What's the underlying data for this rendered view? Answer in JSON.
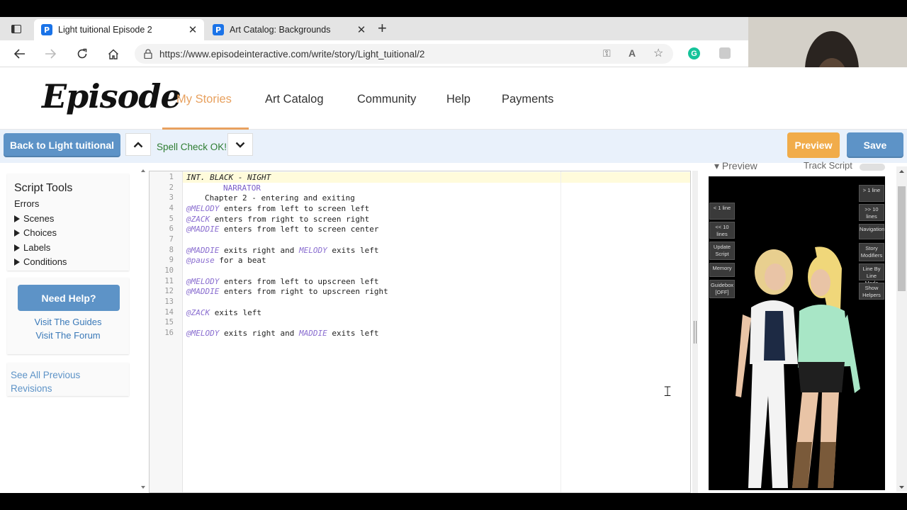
{
  "browser": {
    "tabs": [
      {
        "label": "Light tuitional Episode 2",
        "favicon": "P",
        "active": true
      },
      {
        "label": "Art Catalog: Backgrounds",
        "favicon": "P",
        "active": false
      }
    ],
    "url": "https://www.episodeinteractive.com/write/story/Light_tuitional/2",
    "grammarly_badge": "G"
  },
  "site": {
    "logo": "Episode",
    "nav": [
      "My Stories",
      "Art Catalog",
      "Community",
      "Help",
      "Payments"
    ],
    "active_nav": "My Stories",
    "accent_color": "#e8a15f"
  },
  "toolbar": {
    "back_label": "Back to Light tuitional",
    "spell_status": "Spell Check OK!",
    "preview_label": "Preview",
    "save_label": "Save"
  },
  "sidebar": {
    "title": "Script Tools",
    "errors": "Errors",
    "sections": [
      "Scenes",
      "Choices",
      "Labels",
      "Conditions"
    ],
    "help_button": "Need Help?",
    "guides_link": "Visit The Guides",
    "forum_link": "Visit The Forum",
    "revisions_link": "See All Previous Revisions"
  },
  "editor": {
    "line_numbers": [
      "1",
      "2",
      "3",
      "4",
      "5",
      "6",
      "7",
      "8",
      "9",
      "10",
      "11",
      "12",
      "13",
      "14",
      "15",
      "16"
    ],
    "lines": {
      "l1": "INT. BLACK - NIGHT",
      "l2": "NARRATOR",
      "l3": "Chapter 2 - entering and exiting",
      "l4a": "@MELODY",
      "l4b": " enters from left to screen left",
      "l5a": "@ZACK",
      "l5b": " enters from right to screen right",
      "l6a": "@MADDIE",
      "l6b": " enters from left to screen center",
      "l8a": "@MADDIE",
      "l8b": " exits right and ",
      "l8c": "MELODY",
      "l8d": " exits left",
      "l9a": "@pause",
      "l9b": " for a beat",
      "l11a": "@MELODY",
      "l11b": " enters from left to upscreen left",
      "l12a": "@MADDIE",
      "l12b": " enters from right to upscreen right",
      "l14a": "@ZACK",
      "l14b": " exits left",
      "l16a": "@MELODY",
      "l16b": " exits right and ",
      "l16c": "MADDIE",
      "l16d": " exits left"
    }
  },
  "preview": {
    "title": "Preview",
    "track_label": "Track Script",
    "left_buttons": [
      "< 1 line",
      "<< 10 lines",
      "Update Script",
      "Memory",
      "Guidebox [OFF]"
    ],
    "right_buttons": [
      "> 1 line",
      ">> 10 lines",
      "Navigation",
      "Story Modifiers",
      "Line By Line Mode",
      "Show Helpers"
    ]
  }
}
